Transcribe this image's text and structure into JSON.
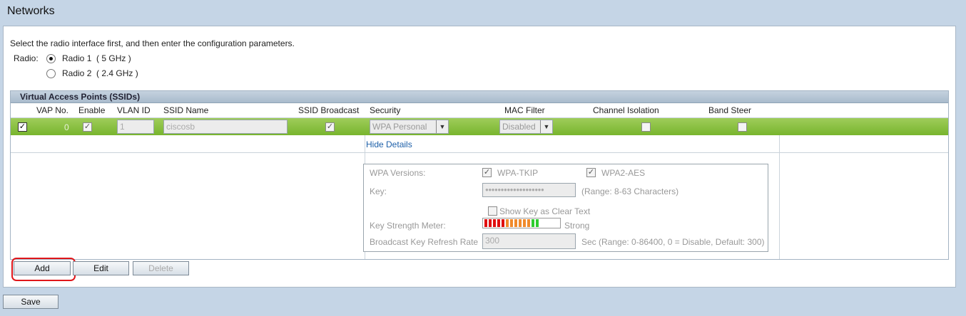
{
  "page": {
    "title": "Networks"
  },
  "radio_section": {
    "instruction": "Select the radio interface first, and then enter the configuration parameters.",
    "label": "Radio:",
    "options": [
      {
        "label": "Radio 1",
        "band": "( 5 GHz )",
        "selected": true
      },
      {
        "label": "Radio 2",
        "band": "( 2.4 GHz )",
        "selected": false
      }
    ]
  },
  "vap_table": {
    "title": "Virtual Access Points (SSIDs)",
    "headers": [
      "VAP No.",
      "Enable",
      "VLAN ID",
      "SSID Name",
      "SSID Broadcast",
      "Security",
      "MAC Filter",
      "Channel Isolation",
      "Band Steer"
    ],
    "row": {
      "vap_no": "0",
      "vlan_id": "1",
      "ssid_name": "ciscosb",
      "security": "WPA Personal",
      "mac_filter": "Disabled"
    },
    "hide_details": "Hide Details"
  },
  "details": {
    "wpa_versions_label": "WPA Versions:",
    "wpa_tkip": "WPA-TKIP",
    "wpa2_aes": "WPA2-AES",
    "key_label": "Key:",
    "key_value": "●●●●●●●●●●●●●●●●●●●",
    "key_range": "(Range: 8-63 Characters)",
    "show_key": "Show Key as Clear Text",
    "strength_label": "Key Strength Meter:",
    "strength_value": "Strong",
    "refresh_label": "Broadcast Key Refresh Rate",
    "refresh_value": "300",
    "refresh_range": "Sec (Range: 0-86400, 0 = Disable, Default: 300)"
  },
  "buttons": {
    "add": "Add",
    "edit": "Edit",
    "delete": "Delete",
    "save": "Save"
  },
  "colors": {
    "selected_row": "#8cc145",
    "highlight": "#e0161a"
  }
}
